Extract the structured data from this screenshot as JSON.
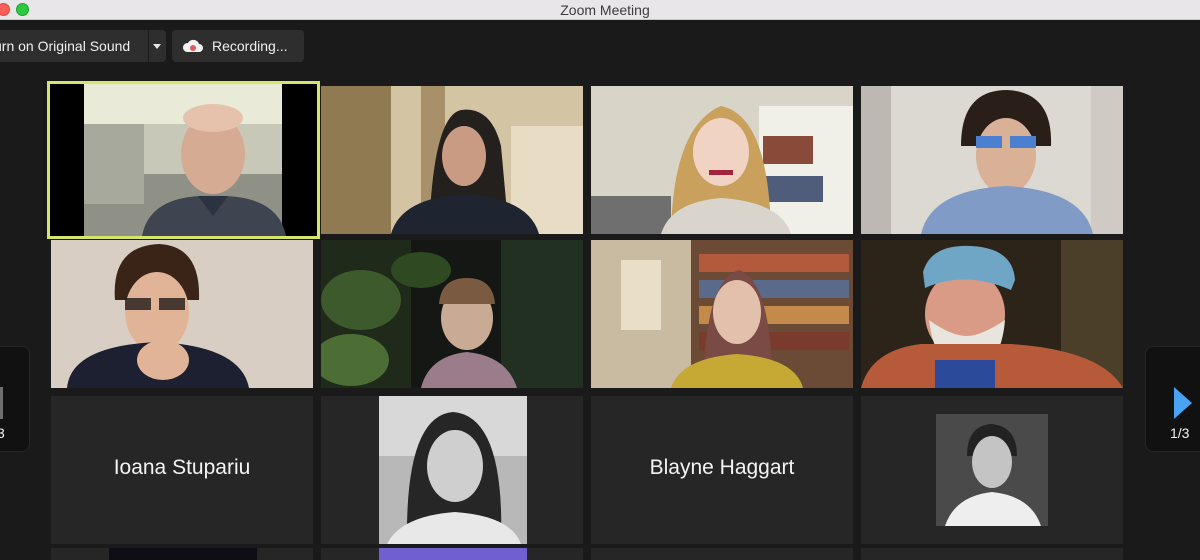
{
  "window": {
    "title": "Zoom Meeting"
  },
  "toolbar": {
    "original_sound_label": "urn on Original Sound",
    "recording_label": "Recording..."
  },
  "pagination": {
    "left_label": "3",
    "right_label": "1/3"
  },
  "participants": [
    {
      "kind": "video",
      "description": "bald man with beard",
      "active_speaker": true
    },
    {
      "kind": "video",
      "description": "woman with dark hair"
    },
    {
      "kind": "video",
      "description": "woman with blonde hair and bookshelf"
    },
    {
      "kind": "video",
      "description": "man with glasses in light sweater"
    },
    {
      "kind": "video",
      "description": "man with glasses, hand on chin"
    },
    {
      "kind": "video",
      "description": "woman with glasses among plants"
    },
    {
      "kind": "video",
      "description": "woman with glasses and bookshelves"
    },
    {
      "kind": "video",
      "description": "older man with bandana and beard"
    },
    {
      "kind": "name",
      "name": "Ioana Stupariu"
    },
    {
      "kind": "photo",
      "description": "woman with curly hair, black and white"
    },
    {
      "kind": "name",
      "name": "Blayne Haggart"
    },
    {
      "kind": "photo",
      "description": "young man with beard, black and white"
    }
  ],
  "colors": {
    "background": "#1a1a1a",
    "tile": "#262626",
    "active_speaker_border": "#d6e66a",
    "next_arrow": "#4aa3f2",
    "recording_icon": "#e05a5a"
  }
}
